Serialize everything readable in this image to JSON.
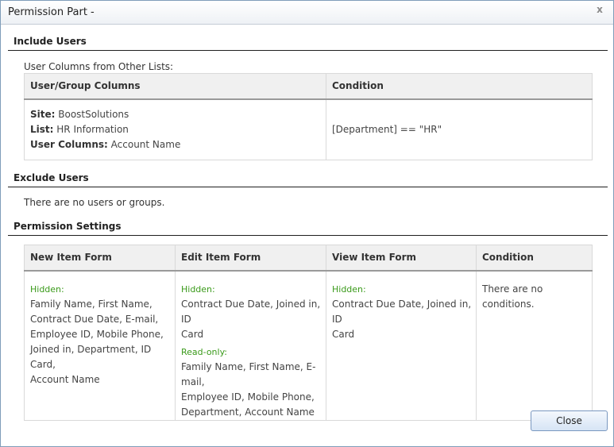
{
  "dialog": {
    "title": "Permission Part -",
    "close_icon": "close-icon",
    "close_glyph": "x"
  },
  "include_users": {
    "title": "Include Users",
    "subtitle": "User Columns from Other Lists:",
    "headers": [
      "User/Group Columns",
      "Condition"
    ],
    "site_label": "Site:",
    "site_value": "BoostSolutions",
    "list_label": "List:",
    "list_value": "HR Information",
    "user_columns_label": "User Columns:",
    "user_columns_value": "Account Name",
    "condition": "[Department] == \"HR\""
  },
  "exclude_users": {
    "title": "Exclude Users",
    "message": "There are no users or groups."
  },
  "permission_settings": {
    "title": "Permission Settings",
    "headers": [
      "New Item Form",
      "Edit Item Form",
      "View Item Form",
      "Condition"
    ],
    "new_item": {
      "hidden_label": "Hidden:",
      "hidden_lines": [
        "Family Name, First Name,",
        "Contract Due Date, E-mail,",
        "Employee ID, Mobile Phone,",
        "Joined in, Department, ID Card,",
        "Account Name"
      ]
    },
    "edit_item": {
      "hidden_label": "Hidden:",
      "hidden_lines": [
        "Contract Due Date, Joined in, ID",
        "Card"
      ],
      "readonly_label": "Read-only:",
      "readonly_lines": [
        "Family Name, First Name, E-mail,",
        "Employee ID, Mobile Phone,",
        "Department, Account Name"
      ]
    },
    "view_item": {
      "hidden_label": "Hidden:",
      "hidden_lines": [
        "Contract Due Date, Joined in, ID",
        "Card"
      ]
    },
    "condition": "There are no conditions."
  },
  "footer": {
    "close_label": "Close"
  }
}
